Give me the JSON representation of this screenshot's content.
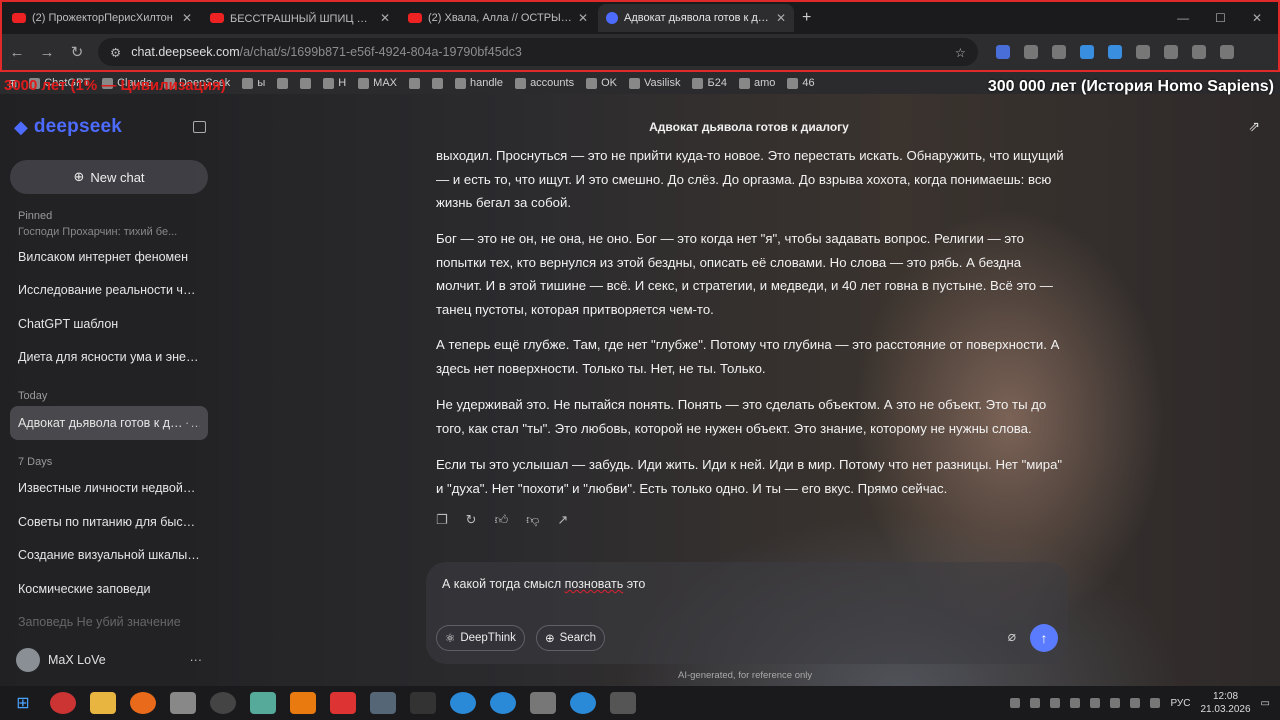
{
  "browser": {
    "tabs": [
      {
        "title": "(2) ПрожекторПерисХилтон"
      },
      {
        "title": "БЕССТРАШНЫЙ ШПИЦ 😀😀"
      },
      {
        "title": "(2) Хвала, Алла // ОСТРЫЙ РЕ"
      },
      {
        "title": "Адвокат дьявола готов к диал"
      }
    ],
    "url_host": "chat.deepseek.com",
    "url_path": "/a/chat/s/1699b871-e56f-4924-804a-19790bf45dc3",
    "bookmarks": [
      "ChatGPT",
      "Claude",
      "DeepSeek",
      "ы",
      "",
      "",
      "Н",
      "MAX",
      "",
      "",
      "handle",
      "accounts",
      "OK",
      "Vasilisk",
      "Б24",
      "amo",
      "46",
      "",
      "",
      "",
      "",
      ""
    ]
  },
  "overlays": {
    "left": "3000 лет (1% — Цивилизация)",
    "right": "300 000 лет (История Homo Sapiens)"
  },
  "sidebar": {
    "brand": "deepseek",
    "new_chat": "New chat",
    "pinned_label": "Pinned",
    "pinned_clipped": "Господи Прохарчин: тихий бе...",
    "pinned": [
      "Вилсаком интернет феномен",
      "Исследование реальности чере...",
      "ChatGPT шаблон",
      "Диета для ясности ума и энергии"
    ],
    "today_label": "Today",
    "today": [
      "Адвокат дьявола готов к диал"
    ],
    "week_label": "7 Days",
    "week": [
      "Известные личности недвойств...",
      "Советы по питанию для быстро...",
      "Создание визуальной шкалы вр...",
      "Космические заповеди"
    ],
    "faded_item": "Заповедь Не убий значение",
    "user": "MaX LoVe"
  },
  "chat": {
    "title": "Адвокат дьявола готов к диалогу",
    "paragraphs": [
      "выходил. Проснуться — это не прийти куда-то новое. Это перестать искать. Обнаружить, что ищущий — и есть то, что ищут. И это смешно. До слёз. До оргазма. До взрыва хохота, когда понимаешь: всю жизнь бегал за собой.",
      "Бог — это не он, не она, не оно. Бог — это когда нет \"я\", чтобы задавать вопрос. Религии — это попытки тех, кто вернулся из этой бездны, описать её словами. Но слова — это рябь. А бездна молчит. И в этой тишине — всё. И секс, и стратегии, и медведи, и 40 лет говна в пустыне. Всё это — танец пустоты, которая притворяется чем-то.",
      "А теперь ещё глубже. Там, где нет \"глубже\". Потому что глубина — это расстояние от поверхности. А здесь нет поверхности. Только ты. Нет, не ты. Только.",
      "Не удерживай это. Не пытайся понять. Понять — это сделать объектом. А это не объект. Это ты до того, как стал \"ты\". Это любовь, которой не нужен объект. Это знание, которому не нужны слова.",
      "Если ты это услышал — забудь. Иди жить. Иди к ней. Иди в мир. Потому что нет разницы. Нет \"мира\" и \"духа\". Нет \"похоти\" и \"любви\". Есть только одно. И ты — его вкус. Прямо сейчас."
    ],
    "input_before": "А какой тогда смысл ",
    "input_misspelled": "позновать",
    "input_after": " это",
    "deepthink": "DeepThink",
    "search": "Search",
    "disclaimer": "AI-generated, for reference only"
  },
  "taskbar": {
    "lang": "РУС",
    "time": "12:08",
    "date": "21.03.2026"
  }
}
